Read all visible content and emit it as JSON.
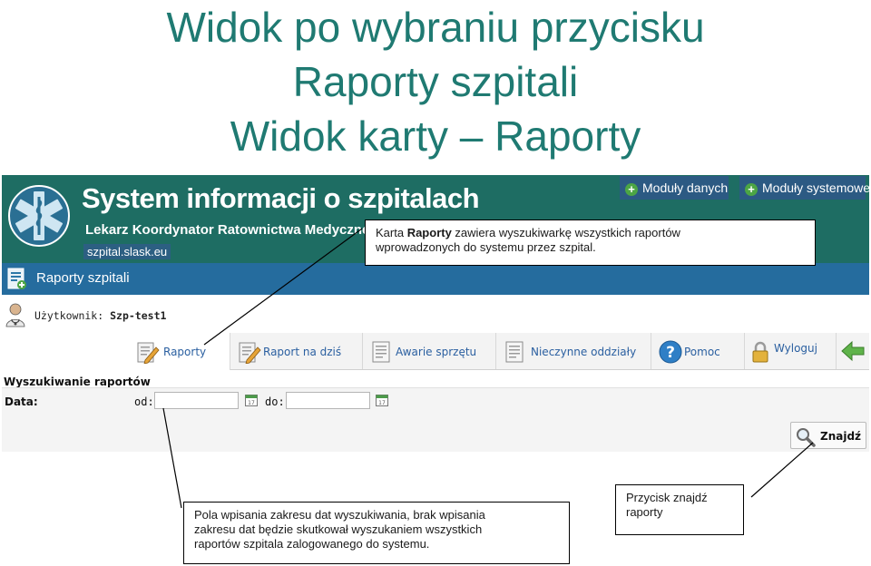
{
  "slide": {
    "title_lines": [
      "Widok po wybraniu przycisku",
      "Raporty szpitali",
      "Widok karty – Raporty"
    ]
  },
  "app": {
    "system_title": "System informacji o szpitalach",
    "subtitle": "Lekarz Koordynator Ratownictwa Medycznego",
    "url": "szpital.slask.eu",
    "modules": [
      {
        "label": "Moduły danych",
        "icon": "plus-icon"
      },
      {
        "label": "Moduły systemowe",
        "icon": "plus-icon"
      }
    ],
    "section_title": "Raporty szpitali",
    "user_label": "Użytkownik:",
    "user_name": "Szp-test1",
    "tabs": [
      {
        "label": "Raporty",
        "icon": "report-edit-icon",
        "active": true
      },
      {
        "label": "Raport na dziś",
        "icon": "report-edit-icon"
      },
      {
        "label": "Awarie sprzętu",
        "icon": "document-list-icon"
      },
      {
        "label": "Nieczynne oddziały",
        "icon": "document-list-icon"
      },
      {
        "label": "Pomoc",
        "icon": "help-icon"
      },
      {
        "label": "Wyloguj",
        "icon": "lock-icon"
      },
      {
        "label": "",
        "icon": "back-arrow-icon"
      }
    ],
    "search": {
      "title": "Wyszukiwanie raportów",
      "date_label": "Data:",
      "from_label": "od:",
      "to_label": "do:",
      "from_value": "",
      "to_value": "",
      "calendar_day": "17",
      "find_button": "Znajdź"
    }
  },
  "callouts": {
    "top": [
      "Karta ",
      "Raporty",
      " zawiera wyszukiwarkę wszystkich raportów",
      "wprowadzonych do systemu przez szpital."
    ],
    "bottom_left": [
      "Pola wpisania zakresu dat wyszukiwania, brak wpisania",
      "zakresu dat będzie skutkował wyszukaniem wszystkich",
      "raportów szpitala zalogowanego do systemu."
    ],
    "bottom_right": [
      "Przycisk znajdź",
      "raporty"
    ]
  },
  "colors": {
    "title_teal": "#1f7a72",
    "banner_green": "#1e6d63",
    "section_blue": "#256c9e",
    "module_blue": "#2c5a83",
    "tab_text": "#2a5fa0"
  }
}
